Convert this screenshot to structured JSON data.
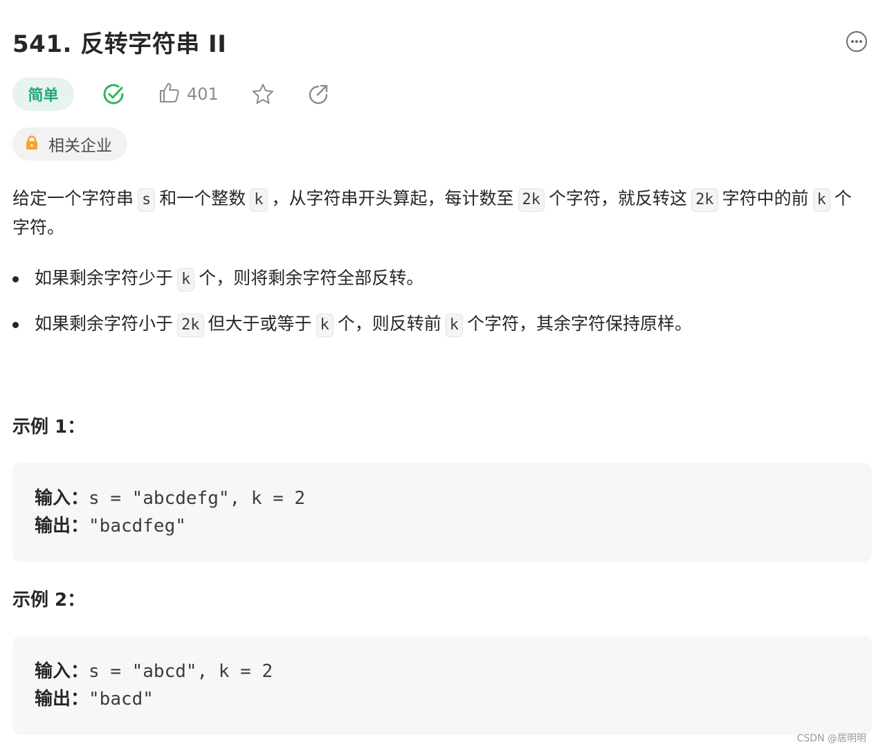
{
  "problem": {
    "title": "541. 反转字符串 II",
    "difficulty": "简单",
    "likes": "401",
    "company_label": "相关企业"
  },
  "description": {
    "p1": "给定一个字符串",
    "code_s": "s",
    "p2": "和一个整数",
    "code_k1": "k",
    "p3": "，从字符串开头算起，每计数至",
    "code_2k1": "2k",
    "p4": "个字符，就反转这",
    "code_2k2": "2k",
    "p5": "字符中的前",
    "code_k2": "k",
    "p6": "个字符。"
  },
  "bullets": [
    {
      "a": "如果剩余字符少于",
      "code1": "k",
      "b": "个，则将剩余字符全部反转。"
    },
    {
      "a": "如果剩余字符小于",
      "code1": "2k",
      "b": "但大于或等于",
      "code2": "k",
      "c": "个，则反转前",
      "code3": "k",
      "d": "个字符，其余字符保持原样。"
    }
  ],
  "examples": [
    {
      "title": "示例 1：",
      "input_label": "输入：",
      "input": "s = \"abcdefg\", k = 2",
      "output_label": "输出：",
      "output": "\"bacdfeg\""
    },
    {
      "title": "示例 2：",
      "input_label": "输入：",
      "input": "s = \"abcd\", k = 2",
      "output_label": "输出：",
      "output": "\"bacd\""
    }
  ],
  "watermark": "CSDN @居明明",
  "icons": {
    "accepted": "check-circle-icon",
    "like": "thumbs-up-icon",
    "favorite": "star-icon",
    "share": "share-icon",
    "more": "more-icon",
    "lock": "lock-icon"
  },
  "colors": {
    "easy_text": "#1fa882",
    "easy_bg": "#e6f3ee",
    "accepted": "#2db55d",
    "lock": "#f5a623"
  }
}
